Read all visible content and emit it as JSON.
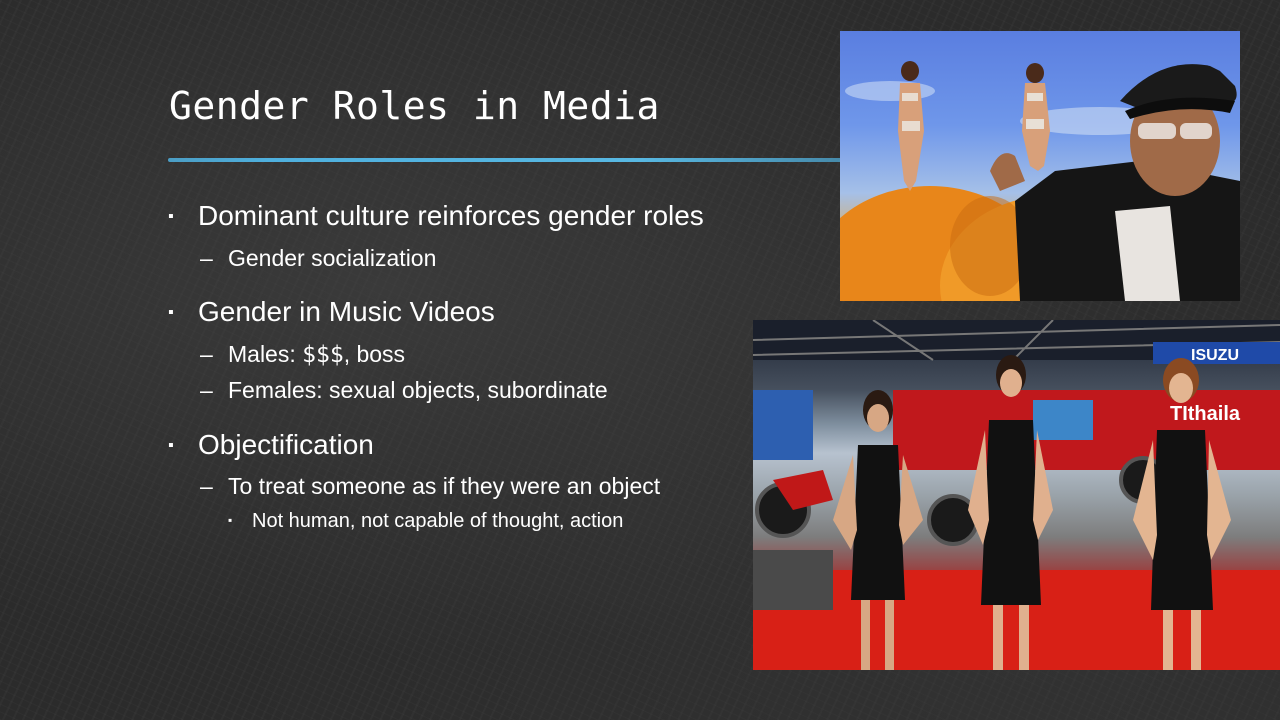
{
  "slide": {
    "title": "Gender Roles in Media",
    "accent_color": "#4fb0de",
    "bullets": [
      {
        "text": "Dominant culture reinforces gender roles"
      },
      {
        "text": "Gender socialization"
      },
      {
        "text": "Gender in Music Videos"
      },
      {
        "prefix": "Males: ",
        "mono": "$$$",
        "suffix": ", boss"
      },
      {
        "text": "Females: sexual objects, subordinate"
      },
      {
        "text": "Objectification"
      },
      {
        "text": "To treat someone as if they were an object"
      },
      {
        "text": "Not human, not capable of thought, action"
      }
    ],
    "markers": {
      "level1": "▪",
      "level2": "–",
      "level3": "▪"
    }
  },
  "images": {
    "top_photo": {
      "description": "music video still: two bikini-clad women on giant peaches, man in black fedora and sunglasses giving thumbs up"
    },
    "bottom_photo": {
      "description": "three women in black dresses posing at a motorcycle expo booth"
    },
    "bottom_photo_signage": [
      "ISUZU",
      "TIthaila"
    ]
  }
}
